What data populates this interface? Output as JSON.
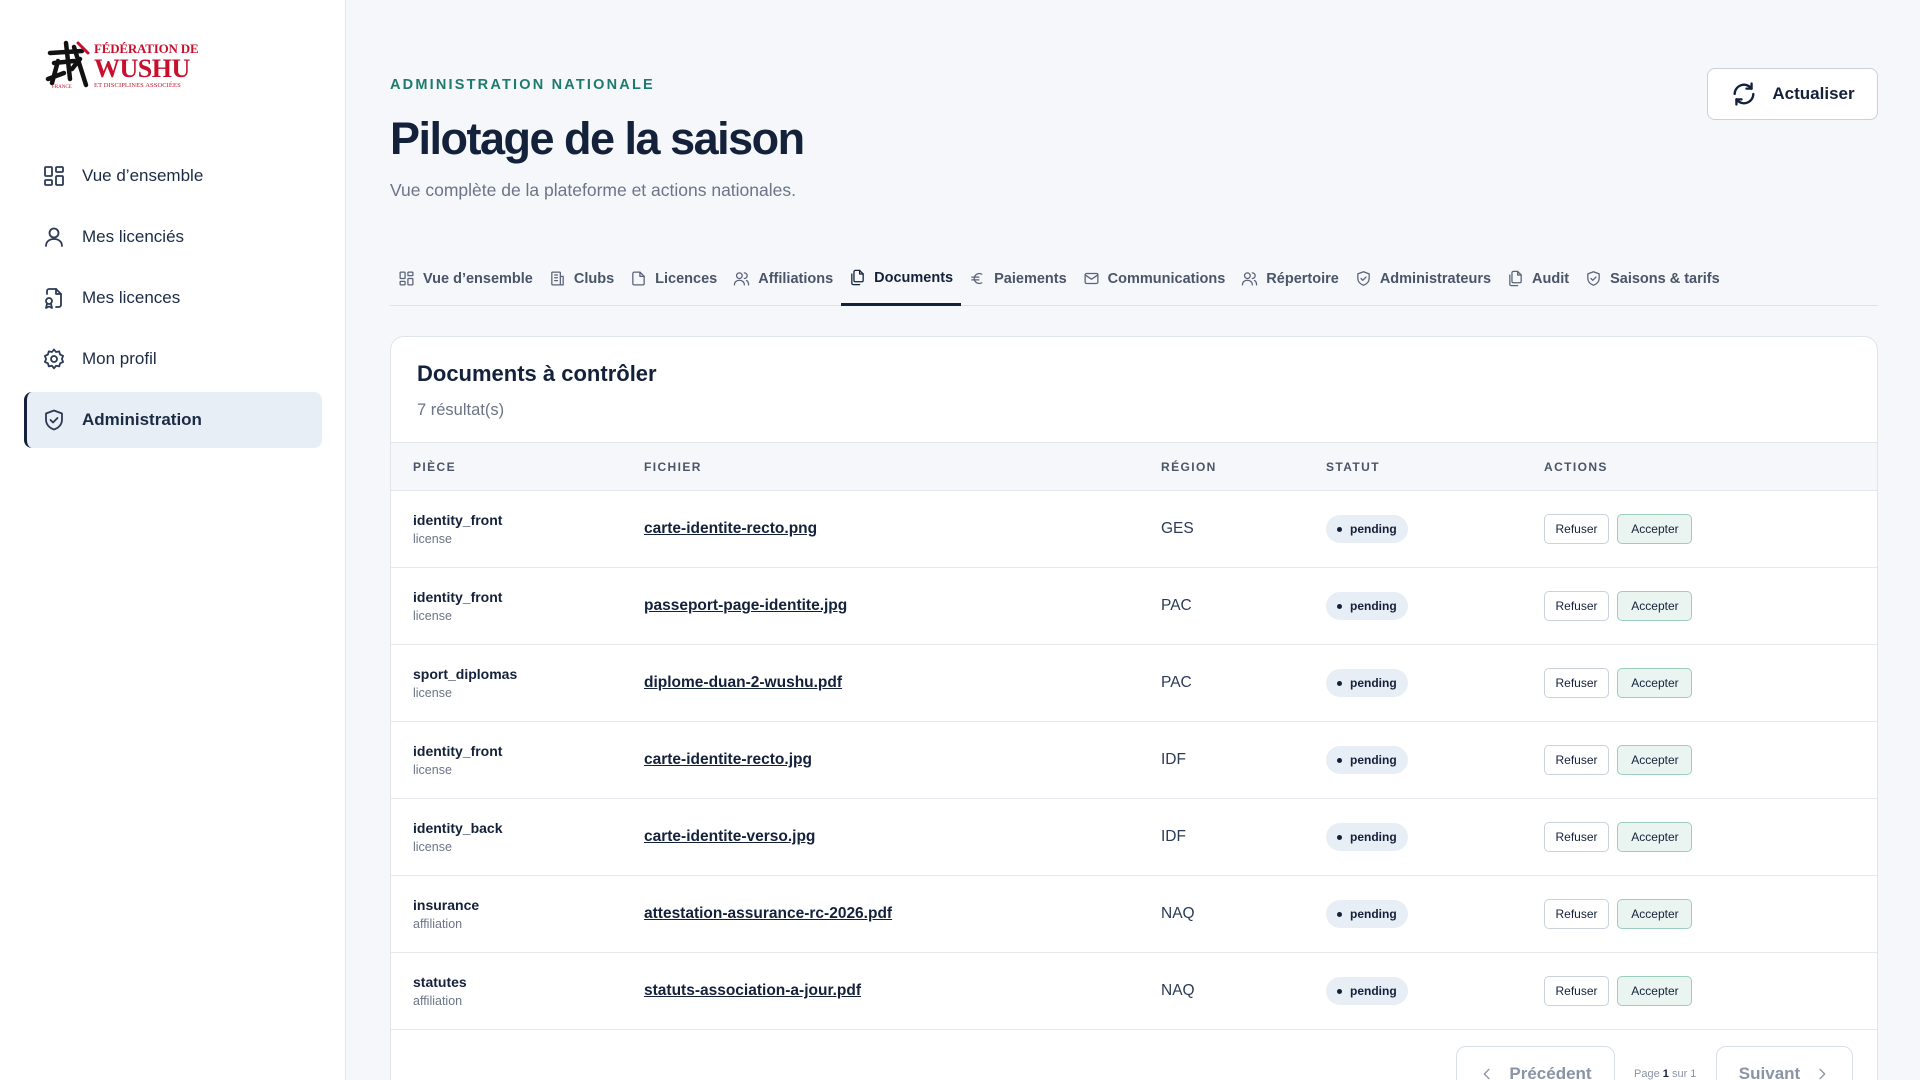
{
  "brand": {
    "line1": "FÉDÉRATION DE",
    "line2": "WUSHU",
    "line3": "ET DISCIPLINES ASSOCIÉES",
    "country": "FRANCE",
    "color": "#c8102e"
  },
  "sidebar": {
    "items": [
      {
        "label": "Vue d’ensemble",
        "icon": "grid-icon"
      },
      {
        "label": "Mes licenciés",
        "icon": "user-icon"
      },
      {
        "label": "Mes licences",
        "icon": "license-icon"
      },
      {
        "label": "Mon profil",
        "icon": "gear-icon"
      },
      {
        "label": "Administration",
        "icon": "shield-icon",
        "active": true
      }
    ]
  },
  "header": {
    "eyebrow": "ADMINISTRATION NATIONALE",
    "title": "Pilotage de la saison",
    "subtitle": "Vue complète de la plateforme et actions nationales.",
    "refresh_label": "Actualiser"
  },
  "tabs": [
    {
      "label": "Vue d’ensemble",
      "icon": "grid-icon"
    },
    {
      "label": "Clubs",
      "icon": "building-icon"
    },
    {
      "label": "Licences",
      "icon": "file-icon"
    },
    {
      "label": "Affiliations",
      "icon": "users-icon"
    },
    {
      "label": "Documents",
      "icon": "documents-icon",
      "active": true
    },
    {
      "label": "Paiements",
      "icon": "euro-icon"
    },
    {
      "label": "Communications",
      "icon": "mail-icon"
    },
    {
      "label": "Répertoire",
      "icon": "users-icon"
    },
    {
      "label": "Administrateurs",
      "icon": "shield-icon"
    },
    {
      "label": "Audit",
      "icon": "copy-icon"
    },
    {
      "label": "Saisons & tarifs",
      "icon": "shield-icon"
    }
  ],
  "card": {
    "title": "Documents à contrôler",
    "count": "7 résultat(s)"
  },
  "table": {
    "headers": [
      "PIÈCE",
      "FICHIER",
      "RÉGION",
      "STATUT",
      "ACTIONS"
    ],
    "rows": [
      {
        "piece": "identity_front",
        "type": "license",
        "file": "carte-identite-recto.png",
        "region": "GES",
        "status": "pending"
      },
      {
        "piece": "identity_front",
        "type": "license",
        "file": "passeport-page-identite.jpg",
        "region": "PAC",
        "status": "pending"
      },
      {
        "piece": "sport_diplomas",
        "type": "license",
        "file": "diplome-duan-2-wushu.pdf",
        "region": "PAC",
        "status": "pending"
      },
      {
        "piece": "identity_front",
        "type": "license",
        "file": "carte-identite-recto.jpg",
        "region": "IDF",
        "status": "pending"
      },
      {
        "piece": "identity_back",
        "type": "license",
        "file": "carte-identite-verso.jpg",
        "region": "IDF",
        "status": "pending"
      },
      {
        "piece": "insurance",
        "type": "affiliation",
        "file": "attestation-assurance-rc-2026.pdf",
        "region": "NAQ",
        "status": "pending"
      },
      {
        "piece": "statutes",
        "type": "affiliation",
        "file": "statuts-association-a-jour.pdf",
        "region": "NAQ",
        "status": "pending"
      }
    ],
    "refuse_label": "Refuser",
    "accept_label": "Accepter"
  },
  "pager": {
    "prev_label": "Précédent",
    "next_label": "Suivant",
    "page_prefix": "Page",
    "page_current": "1",
    "page_sep": "sur",
    "page_total": "1"
  }
}
